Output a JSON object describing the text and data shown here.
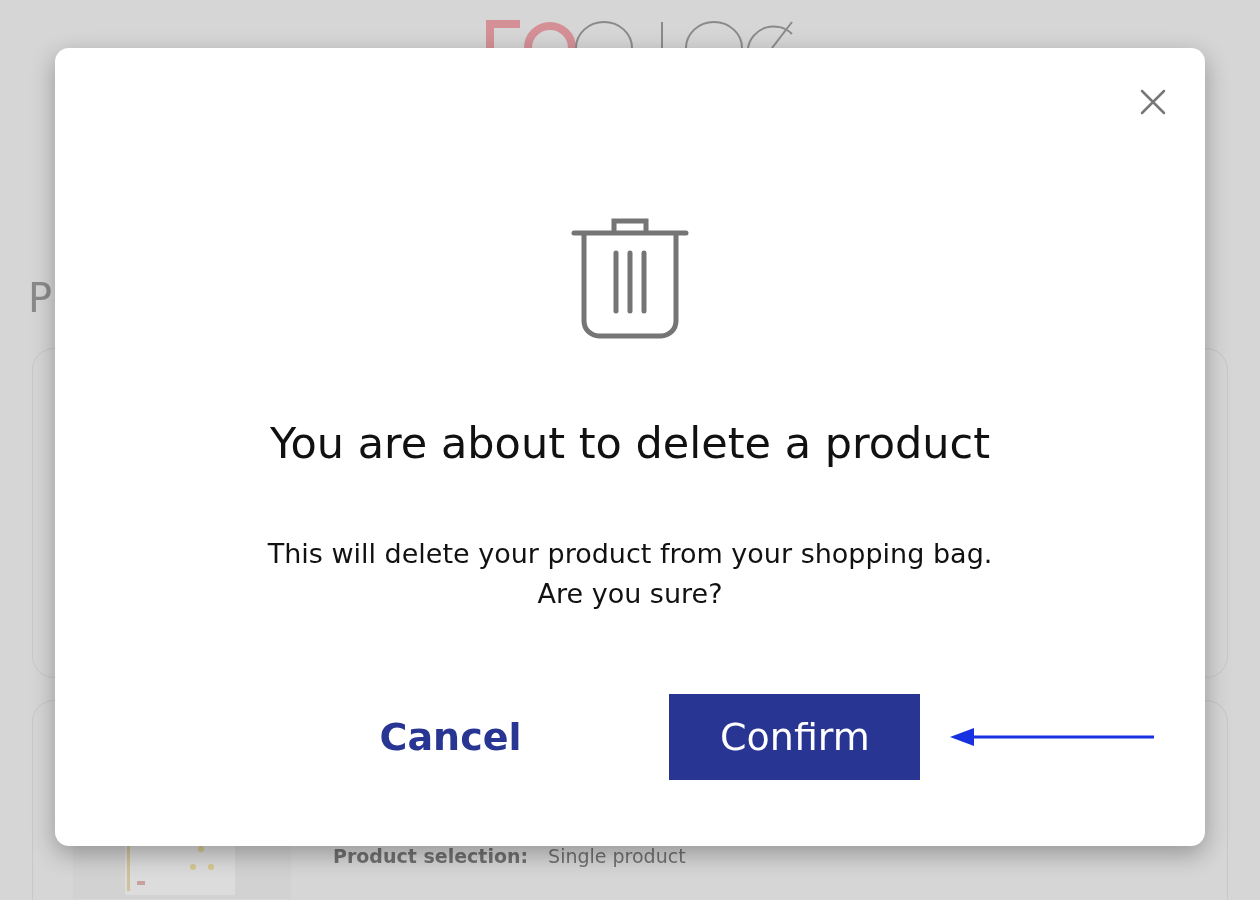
{
  "background": {
    "heading": "P",
    "cards": [
      {
        "kind": "empty"
      },
      {
        "kind": "product",
        "detail_label": "Product selection:",
        "detail_value": "Single product"
      }
    ]
  },
  "dialog": {
    "title": "You are about to delete a product",
    "message": [
      "This will delete your product from your shopping bag.",
      "Are you sure?"
    ],
    "buttons": [
      {
        "kind": "secondary",
        "label": "Cancel"
      },
      {
        "kind": "primary",
        "label": "Confirm",
        "highlighted": true
      }
    ]
  }
}
